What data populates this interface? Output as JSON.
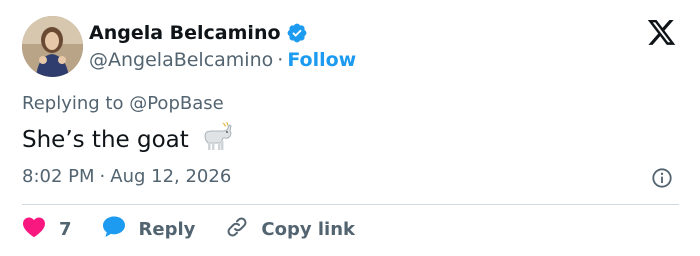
{
  "author": {
    "display_name": "Angela Belcamino",
    "handle": "@AngelaBelcamino",
    "separator": "·",
    "follow_label": "Follow"
  },
  "tweet": {
    "replying_to_prefix": "Replying to",
    "replying_to_handle": "@PopBase",
    "text": "She’s the goat",
    "emoji": "🐐",
    "time": "8:02 PM",
    "separator": "·",
    "date": "Aug 12, 2026"
  },
  "actions": {
    "like_count": "7",
    "reply_label": "Reply",
    "copy_link_label": "Copy link"
  },
  "icons": {
    "verified": "verified-badge-icon",
    "brand": "x-logo-icon",
    "info": "info-icon",
    "like": "heart-icon",
    "reply": "speech-bubble-icon",
    "copy": "link-icon"
  },
  "colors": {
    "accent": "#1d9bf0",
    "like": "#f91880",
    "text_primary": "#0f1419",
    "text_secondary": "#536471",
    "divider": "#cfd9de"
  }
}
